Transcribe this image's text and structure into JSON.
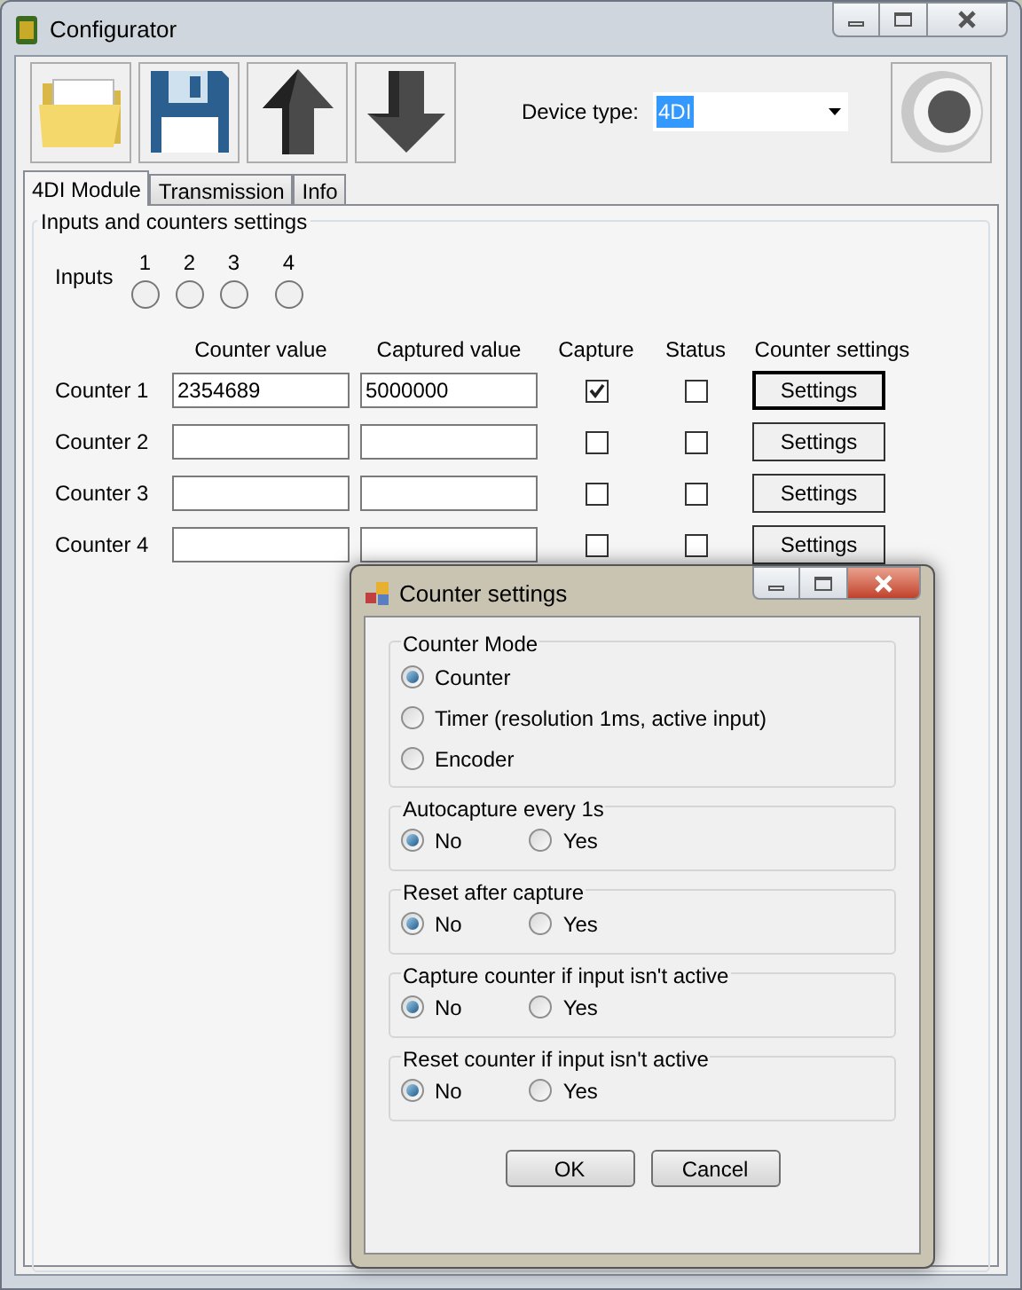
{
  "window": {
    "title": "Configurator"
  },
  "toolbar": {
    "device_type_label": "Device type:",
    "device_type": "4DI"
  },
  "tabs": [
    {
      "label": "4DI Module",
      "selected": true
    },
    {
      "label": "Transmission",
      "selected": false
    },
    {
      "label": "Info",
      "selected": false
    }
  ],
  "group": {
    "title": "Inputs and counters settings",
    "inputs_label": "Inputs",
    "inputs": [
      {
        "label": "1"
      },
      {
        "label": "2"
      },
      {
        "label": "3"
      },
      {
        "label": "4"
      }
    ],
    "columns": [
      "Counter value",
      "Captured value",
      "Capture",
      "Status",
      "Counter settings"
    ],
    "counters": [
      {
        "name": "Counter 1",
        "counter_value": "2354689",
        "captured_value": "5000000",
        "capture": true,
        "status": false,
        "button": "Settings",
        "focused": true
      },
      {
        "name": "Counter 2",
        "capture": false,
        "status": false,
        "button": "Settings",
        "focused": false
      },
      {
        "name": "Counter 3",
        "capture": false,
        "status": false,
        "button": "Settings",
        "focused": false
      },
      {
        "name": "Counter 4",
        "capture": false,
        "status": false,
        "button": "Settings",
        "focused": false
      }
    ]
  },
  "dialog": {
    "title": "Counter settings",
    "groups": [
      {
        "title": "Counter Mode",
        "kind": "column",
        "options": [
          {
            "label": "Counter",
            "selected": true
          },
          {
            "label": "Timer (resolution 1ms, active input)",
            "selected": false
          },
          {
            "label": "Encoder",
            "selected": false
          }
        ]
      },
      {
        "title": "Autocapture every 1s",
        "kind": "row",
        "options": [
          {
            "label": "No",
            "selected": true
          },
          {
            "label": "Yes",
            "selected": false
          }
        ]
      },
      {
        "title": "Reset after capture",
        "kind": "row",
        "options": [
          {
            "label": "No",
            "selected": true
          },
          {
            "label": "Yes",
            "selected": false
          }
        ]
      },
      {
        "title": "Capture counter if input isn't active",
        "kind": "row",
        "options": [
          {
            "label": "No",
            "selected": true
          },
          {
            "label": "Yes",
            "selected": false
          }
        ]
      },
      {
        "title": "Reset counter if input isn't active",
        "kind": "row",
        "options": [
          {
            "label": "No",
            "selected": true
          },
          {
            "label": "Yes",
            "selected": false
          }
        ]
      }
    ],
    "buttons": [
      "OK",
      "Cancel"
    ]
  }
}
